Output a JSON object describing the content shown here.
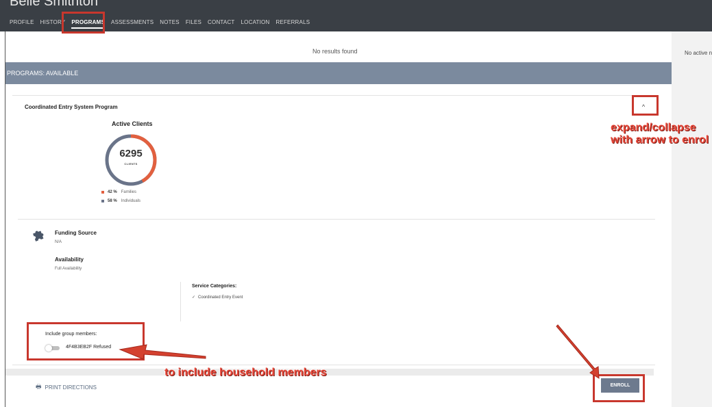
{
  "client": {
    "name": "Belle Smithton"
  },
  "tabs": [
    {
      "label": "PROFILE"
    },
    {
      "label": "HISTORY"
    },
    {
      "label": "PROGRAMS"
    },
    {
      "label": "ASSESSMENTS"
    },
    {
      "label": "NOTES"
    },
    {
      "label": "FILES"
    },
    {
      "label": "CONTACT"
    },
    {
      "label": "LOCATION"
    },
    {
      "label": "REFERRALS"
    }
  ],
  "enrolled": {
    "empty_text": "No results found"
  },
  "right_panel": {
    "text": "No active n"
  },
  "section": {
    "title": "PROGRAMS: AVAILABLE"
  },
  "program": {
    "title": "Coordinated Entry System Program",
    "collapse_icon": "^",
    "active_clients": {
      "title": "Active Clients",
      "total": "6295",
      "unit": "CLIENTS",
      "legend": [
        {
          "pct": "42 %",
          "label": "Families",
          "value": 42,
          "color": "#e2603f"
        },
        {
          "pct": "58 %",
          "label": "Individuals",
          "value": 58,
          "color": "#6a7489"
        }
      ]
    },
    "funding": {
      "label": "Funding Source",
      "value": "N/A",
      "icon": "puzzle-icon"
    },
    "availability": {
      "label": "Availability",
      "value": "Full Availability"
    },
    "service": {
      "title": "Service Categories:",
      "items": [
        "Coordinated Entry Event"
      ]
    },
    "group": {
      "label": "Include group members:",
      "member": "4F4B3EB2F Refused",
      "toggle_on": false
    },
    "print_label": "PRINT DIRECTIONS",
    "enroll_label": "ENROLL"
  },
  "annotations": {
    "expand": "expand/collapse",
    "expand2": "with arrow to enrol",
    "household": "to include household members"
  },
  "colors": {
    "accent": "#c8372d",
    "section_bar": "#7b8a9e",
    "topbar": "#3a3f45"
  }
}
